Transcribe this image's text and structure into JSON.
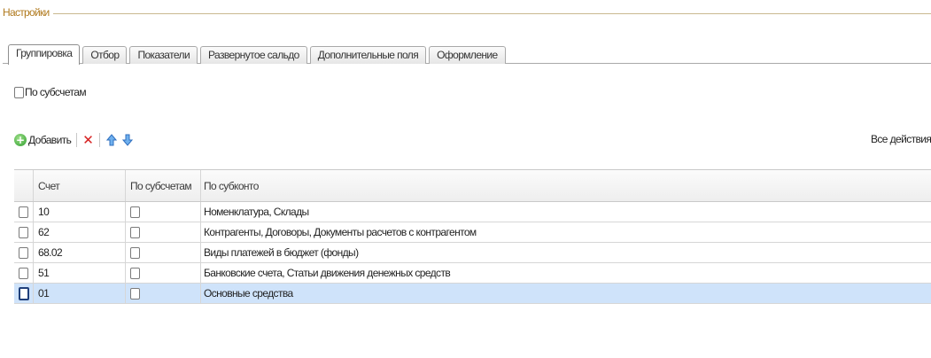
{
  "settings": {
    "group_title": "Настройки"
  },
  "tabs": [
    {
      "label": "Группировка",
      "active": true
    },
    {
      "label": "Отбор",
      "active": false
    },
    {
      "label": "Показатели",
      "active": false
    },
    {
      "label": "Развернутое сальдо",
      "active": false
    },
    {
      "label": "Дополнительные поля",
      "active": false
    },
    {
      "label": "Оформление",
      "active": false
    }
  ],
  "by_subaccounts": {
    "label": "По субсчетам",
    "checked": false
  },
  "toolbar": {
    "add_label": "Добавить",
    "add_icon": "add-circle-icon",
    "delete_icon": "delete-icon",
    "up_icon": "arrow-up-icon",
    "down_icon": "arrow-down-icon",
    "all_actions_label": "Все действия"
  },
  "table": {
    "columns": [
      "Счет",
      "По субсчетам",
      "По субконто"
    ],
    "rows": [
      {
        "account": "10",
        "by_subaccounts": false,
        "subconto": "Номенклатура, Склады",
        "selected": false
      },
      {
        "account": "62",
        "by_subaccounts": false,
        "subconto": "Контрагенты, Договоры, Документы расчетов с контрагентом",
        "selected": false
      },
      {
        "account": "68.02",
        "by_subaccounts": false,
        "subconto": "Виды платежей в бюджет (фонды)",
        "selected": false
      },
      {
        "account": "51",
        "by_subaccounts": false,
        "subconto": "Банковские счета, Статьи движения денежных средств",
        "selected": false
      },
      {
        "account": "01",
        "by_subaccounts": false,
        "subconto": "Основные средства",
        "selected": true
      }
    ]
  },
  "colors": {
    "group_title": "#b07a1e",
    "selected_row": "#cfe3fa",
    "add_icon": "#2f9e2f",
    "delete_icon": "#d62020",
    "arrow_icon": "#3a7fd5"
  }
}
